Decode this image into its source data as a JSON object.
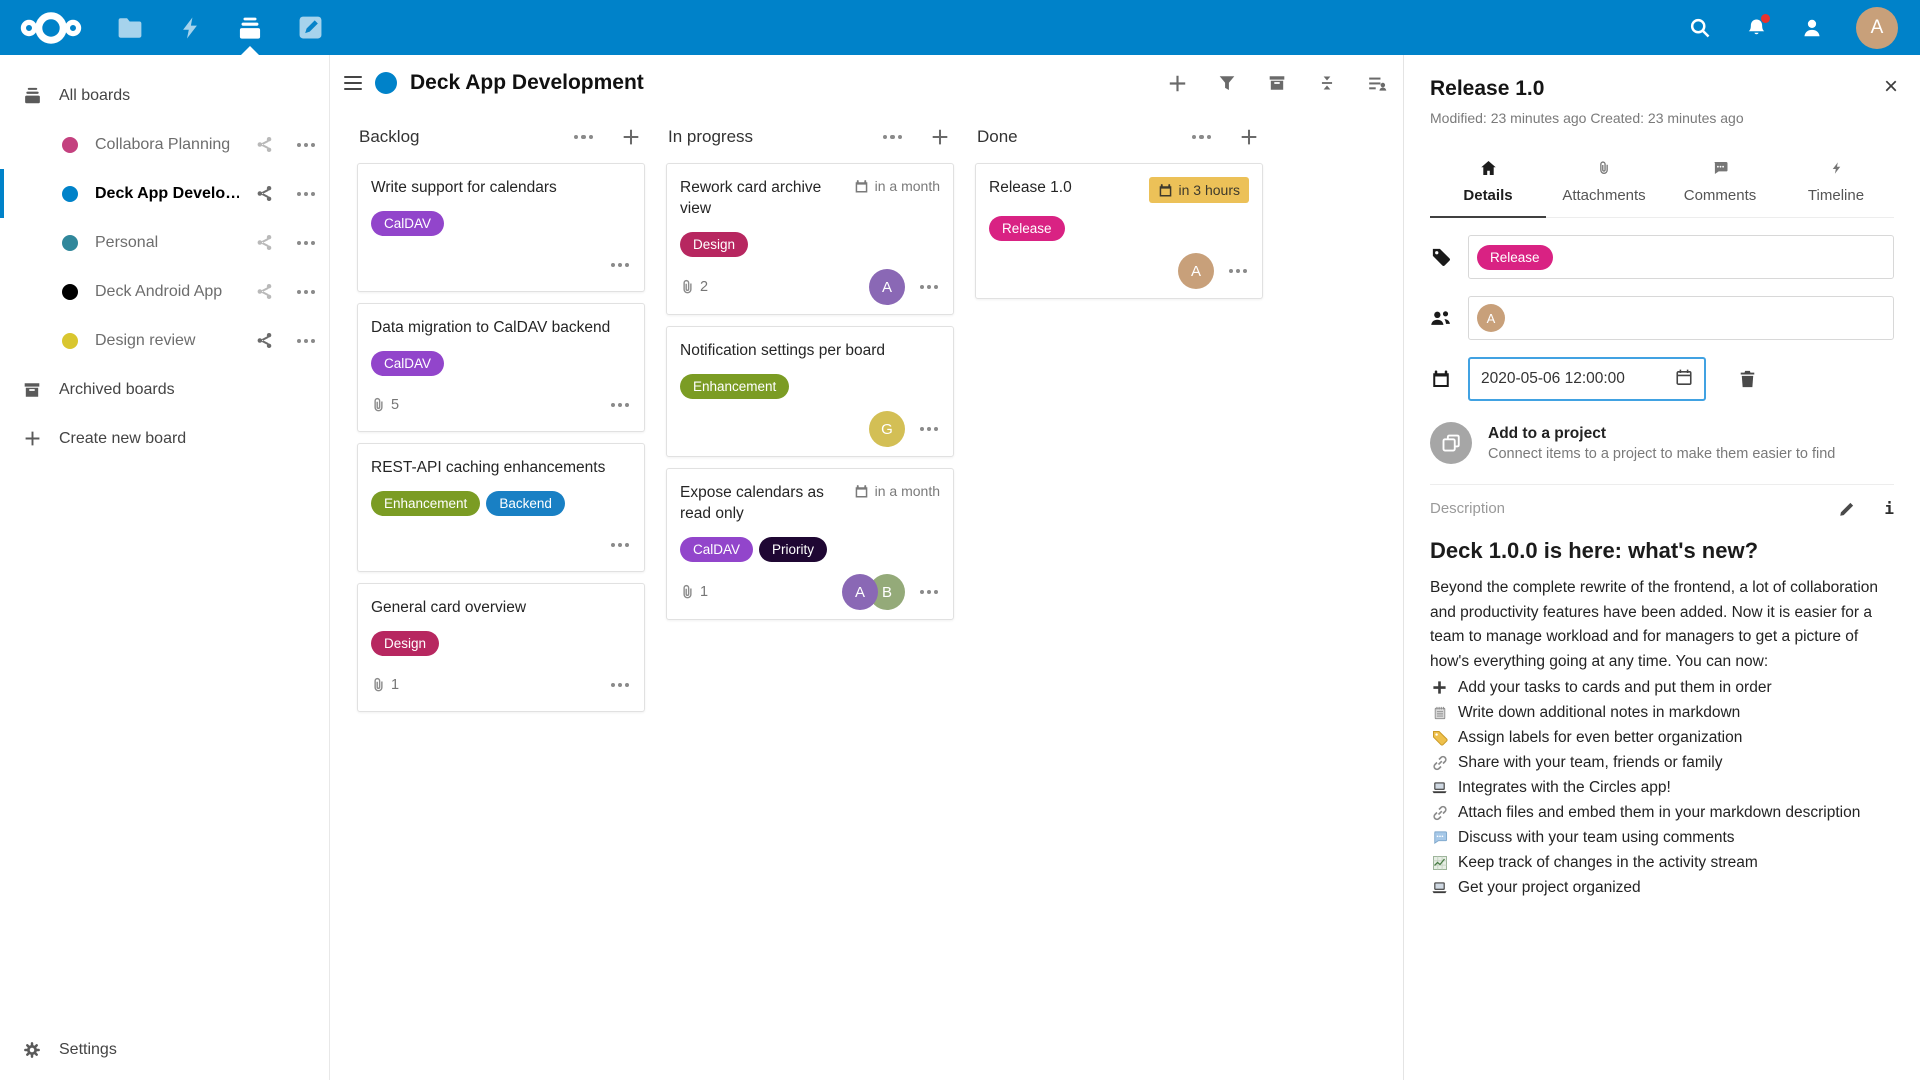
{
  "topbar": {
    "brand_color": "#0082c9",
    "avatar_initial": "A",
    "avatar_color": "#c8a07a"
  },
  "sidebar": {
    "all_boards_label": "All boards",
    "boards": [
      {
        "name": "Collabora Planning",
        "color": "#c4417f"
      },
      {
        "name": "Deck App Develo…",
        "color": "#0082c9",
        "active": true
      },
      {
        "name": "Personal",
        "color": "#30879b"
      },
      {
        "name": "Deck Android App",
        "color": "#000000"
      },
      {
        "name": "Design review",
        "color": "#d9c62f"
      }
    ],
    "archived_label": "Archived boards",
    "create_label": "Create new board",
    "settings_label": "Settings"
  },
  "board": {
    "title": "Deck App Development",
    "color": "#0082c9",
    "columns": [
      {
        "name": "Backlog",
        "cards": [
          {
            "title": "Write support for calendars",
            "labels": [
              {
                "text": "CalDAV",
                "color": "#9245cb"
              }
            ]
          },
          {
            "title": "Data migration to CalDAV backend",
            "labels": [
              {
                "text": "CalDAV",
                "color": "#9245cb"
              }
            ],
            "attachments": "5"
          },
          {
            "title": "REST-API caching enhancements",
            "labels": [
              {
                "text": "Enhancement",
                "color": "#7b9c24"
              },
              {
                "text": "Backend",
                "color": "#1980c4"
              }
            ]
          },
          {
            "title": "General card overview",
            "labels": [
              {
                "text": "Design",
                "color": "#b72760"
              }
            ],
            "attachments": "1"
          }
        ]
      },
      {
        "name": "In progress",
        "cards": [
          {
            "title": "Rework card archive view",
            "due": "in a month",
            "labels": [
              {
                "text": "Design",
                "color": "#b72760"
              }
            ],
            "attachments": "2",
            "avatars": [
              {
                "initial": "A",
                "color": "#8a68b5"
              }
            ]
          },
          {
            "title": "Notification settings per board",
            "labels": [
              {
                "text": "Enhancement",
                "color": "#7b9c24"
              }
            ],
            "avatars": [
              {
                "initial": "G",
                "color": "#d3bf55"
              }
            ]
          },
          {
            "title": "Expose calendars as read only",
            "due": "in a month",
            "labels": [
              {
                "text": "CalDAV",
                "color": "#9245cb"
              },
              {
                "text": "Priority",
                "color": "#1f0733"
              }
            ],
            "attachments": "1",
            "avatars": [
              {
                "initial": "A",
                "color": "#8a68b5"
              },
              {
                "initial": "B",
                "color": "#94aa79"
              }
            ]
          }
        ]
      },
      {
        "name": "Done",
        "cards": [
          {
            "title": "Release 1.0",
            "due": "in 3 hours",
            "due_badge_color": "#ecc158",
            "labels": [
              {
                "text": "Release",
                "color": "#d92283"
              }
            ],
            "avatars": [
              {
                "initial": "A",
                "color": "#c8a07a"
              }
            ]
          }
        ]
      }
    ]
  },
  "panel": {
    "title": "Release 1.0",
    "meta": "Modified: 23 minutes ago Created: 23 minutes ago",
    "close_label": "×",
    "tabs": [
      {
        "label": "Details",
        "active": true
      },
      {
        "label": "Attachments"
      },
      {
        "label": "Comments"
      },
      {
        "label": "Timeline"
      }
    ],
    "tag_chip": {
      "text": "Release",
      "color": "#d92283"
    },
    "assignee": {
      "initial": "A",
      "color": "#c8a07a"
    },
    "due_value": "2020-05-06 12:00:00",
    "project": {
      "title": "Add to a project",
      "subtitle": "Connect items to a project to make them easier to find"
    },
    "description": {
      "label": "Description",
      "heading": "Deck 1.0.0 is here: what's new?",
      "intro": "Beyond the complete rewrite of the frontend, a lot of collaboration and productivity features have been added. Now it is easier for a team to manage workload and for managers to get a picture of how's everything going at any time. You can now:",
      "items": [
        {
          "icon": "plus-icon",
          "text": "Add your tasks to cards and put them in order"
        },
        {
          "icon": "note-icon",
          "text": "Write down additional notes in markdown"
        },
        {
          "icon": "label-icon",
          "text": "Assign labels for even better organization"
        },
        {
          "icon": "link-icon",
          "text": "Share with your team, friends or family"
        },
        {
          "icon": "laptop-icon",
          "text": "Integrates with the Circles app!"
        },
        {
          "icon": "link-icon",
          "text": "Attach files and embed them in your markdown description"
        },
        {
          "icon": "comment-icon",
          "text": "Discuss with your team using comments"
        },
        {
          "icon": "chart-icon",
          "text": "Keep track of changes in the activity stream"
        },
        {
          "icon": "laptop-icon",
          "text": "Get your project organized"
        }
      ]
    }
  }
}
